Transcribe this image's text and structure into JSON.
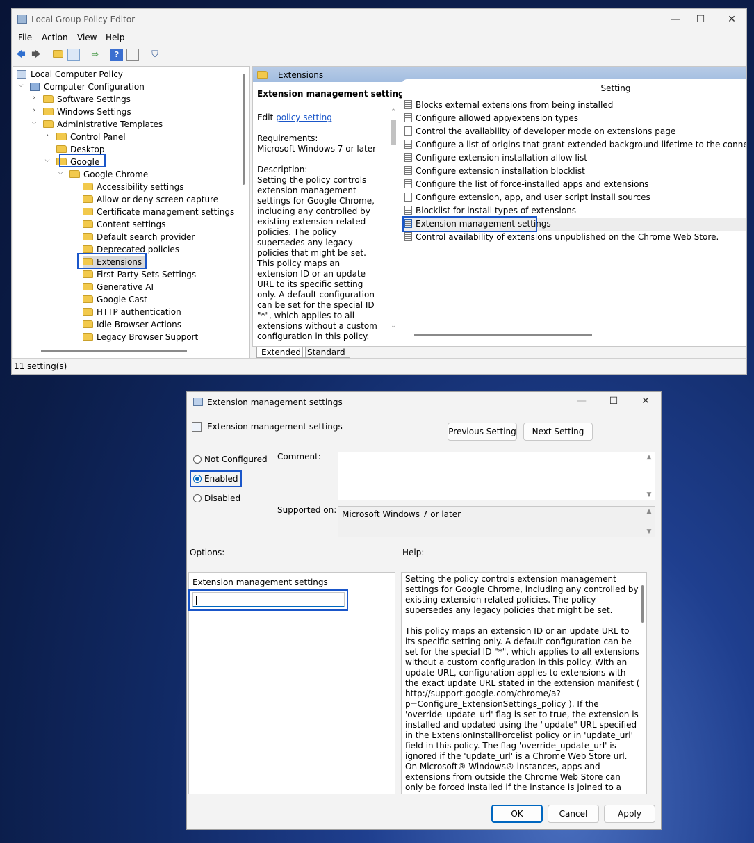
{
  "main_window": {
    "title": "Local Group Policy Editor",
    "menu": [
      "File",
      "Action",
      "View",
      "Help"
    ],
    "tree": [
      {
        "label": "Local Computer Policy",
        "level": 0
      },
      {
        "label": "Computer Configuration",
        "level": 1
      },
      {
        "label": "Software Settings",
        "level": 2
      },
      {
        "label": "Windows Settings",
        "level": 2
      },
      {
        "label": "Administrative Templates",
        "level": 2
      },
      {
        "label": "Control Panel",
        "level": 3
      },
      {
        "label": "Desktop",
        "level": 3
      },
      {
        "label": "Google",
        "level": 3
      },
      {
        "label": "Google Chrome",
        "level": 4
      },
      {
        "label": "Accessibility settings",
        "level": 5
      },
      {
        "label": "Allow or deny screen capture",
        "level": 5
      },
      {
        "label": "Certificate management settings",
        "level": 5
      },
      {
        "label": "Content settings",
        "level": 5
      },
      {
        "label": "Default search provider",
        "level": 5
      },
      {
        "label": "Deprecated policies",
        "level": 5
      },
      {
        "label": "Extensions",
        "level": 5
      },
      {
        "label": "First-Party Sets Settings",
        "level": 5
      },
      {
        "label": "Generative AI",
        "level": 5
      },
      {
        "label": "Google Cast",
        "level": 5
      },
      {
        "label": "HTTP authentication",
        "level": 5
      },
      {
        "label": "Idle Browser Actions",
        "level": 5
      },
      {
        "label": "Legacy Browser Support",
        "level": 5
      }
    ],
    "right_header": "Extensions",
    "desc": {
      "title": "Extension management settings",
      "edit_prefix": "Edit",
      "edit_link": "policy setting",
      "requirements_label": "Requirements:",
      "requirements_value": "Microsoft Windows 7 or later",
      "description_label": "Description:",
      "description_p1": "Setting the policy controls extension management settings for Google Chrome, including any controlled by existing extension-related policies. The policy supersedes any legacy policies that might be set.",
      "description_p2": "This policy maps an extension ID or an update URL to its specific setting only. A default configuration can be set for the special ID \"*\", which applies to all extensions without a custom configuration in this policy. With an update URL, configuration applies to extensions with the exact update URL stated in the"
    },
    "list_header": "Setting",
    "settings": [
      "Blocks external extensions from being installed",
      "Configure allowed app/extension types",
      "Control the availability of developer mode on extensions page",
      "Configure a list of origins that grant extended background lifetime to the connecting extensions",
      "Configure extension installation allow list",
      "Configure extension installation blocklist",
      "Configure the list of force-installed apps and extensions",
      "Configure extension, app, and user script install sources",
      "Blocklist for install types of extensions",
      "Extension management settings",
      "Control availability of extensions unpublished on the Chrome Web Store."
    ],
    "tabs": [
      "Extended",
      "Standard"
    ],
    "status": "11 setting(s)"
  },
  "dialog": {
    "title": "Extension management settings",
    "subtitle": "Extension management settings",
    "prev_button": "Previous Setting",
    "next_button": "Next Setting",
    "radio_not_configured": "Not Configured",
    "radio_enabled": "Enabled",
    "radio_disabled": "Disabled",
    "selected_state": "Enabled",
    "comment_label": "Comment:",
    "supported_label": "Supported on:",
    "supported_value": "Microsoft Windows 7 or later",
    "options_label": "Options:",
    "help_label": "Help:",
    "option_field_label": "Extension management settings",
    "option_field_value": "",
    "help_p1": "Setting the policy controls extension management settings for Google Chrome, including any controlled by existing extension-related policies. The policy supersedes any legacy policies that might be set.",
    "help_p2": "This policy maps an extension ID or an update URL to its specific setting only. A default configuration can be set for the special ID \"*\", which applies to all extensions without a custom configuration in this policy. With an update URL, configuration applies to extensions with the exact update URL stated in the extension manifest ( http://support.google.com/chrome/a?p=Configure_ExtensionSettings_policy ). If the 'override_update_url' flag is set to true, the extension is installed and updated using the \"update\" URL specified in the ExtensionInstallForcelist policy or in 'update_url' field in this policy. The flag 'override_update_url' is ignored if the 'update_url' is a Chrome Web Store url.",
    "help_p3": "On Microsoft® Windows® instances, apps and extensions from outside the Chrome Web Store can only be forced installed if the instance is joined to a Microsoft® Active Directory® domain,",
    "ok_button": "OK",
    "cancel_button": "Cancel",
    "apply_button": "Apply"
  }
}
